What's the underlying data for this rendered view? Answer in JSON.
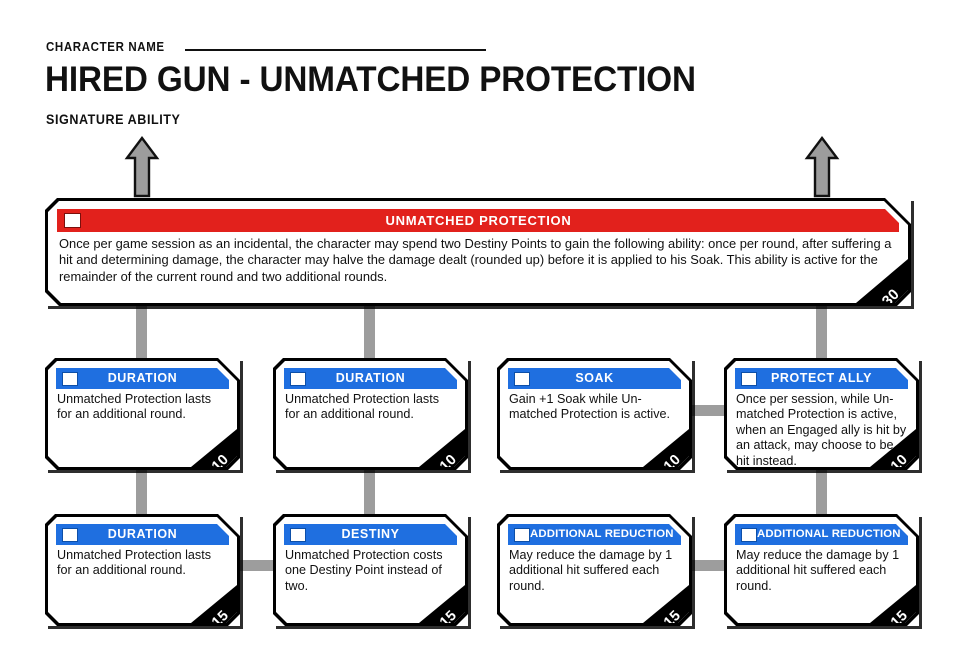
{
  "header": {
    "character_name_label": "CHARACTER NAME",
    "character_name_value": "",
    "title": "HIRED GUN - UNMATCHED PROTECTION",
    "subtitle": "SIGNATURE ABILITY"
  },
  "main_card": {
    "title": "UNMATCHED PROTECTION",
    "cost": "30",
    "checkbox_checked": false,
    "text": "Once per game session as an incidental, the character may spend two Destiny Points to gain the following ability: once per round, after suffering a hit and determining damage, the character may halve the damage dealt (rounded up) before it is applied to his Soak. This ability is active for the remainder of the current round and two additional rounds.",
    "header_color": "#e2211c"
  },
  "upgrade_header_color": "#1f6fe0",
  "connector_color": "#9d9d9d",
  "row1": [
    {
      "title": "DURATION",
      "cost": "10",
      "checkbox_checked": false,
      "text": "Unmatched Protection lasts for an additional round."
    },
    {
      "title": "DURATION",
      "cost": "10",
      "checkbox_checked": false,
      "text": "Unmatched Protection lasts for an additional round."
    },
    {
      "title": "SOAK",
      "cost": "10",
      "checkbox_checked": false,
      "text": "Gain +1 Soak while Un-matched Protection is active."
    },
    {
      "title": "PROTECT ALLY",
      "cost": "10",
      "checkbox_checked": false,
      "text": "Once per session, while Un-matched Protection is active, when an Engaged ally is hit by an attack, may choose to be  hit instead."
    }
  ],
  "row2": [
    {
      "title": "DURATION",
      "cost": "15",
      "checkbox_checked": false,
      "text": "Unmatched Protection lasts for an additional round."
    },
    {
      "title": "DESTINY",
      "cost": "15",
      "checkbox_checked": false,
      "text": "Unmatched Protection costs one Destiny Point instead of two."
    },
    {
      "title": "ADDITIONAL REDUCTION",
      "cost": "15",
      "checkbox_checked": false,
      "text": "May reduce the damage by 1 additional hit suffered each round."
    },
    {
      "title": "ADDITIONAL REDUCTION",
      "cost": "15",
      "checkbox_checked": false,
      "text": "May reduce the damage by 1 additional hit suffered each round."
    }
  ]
}
